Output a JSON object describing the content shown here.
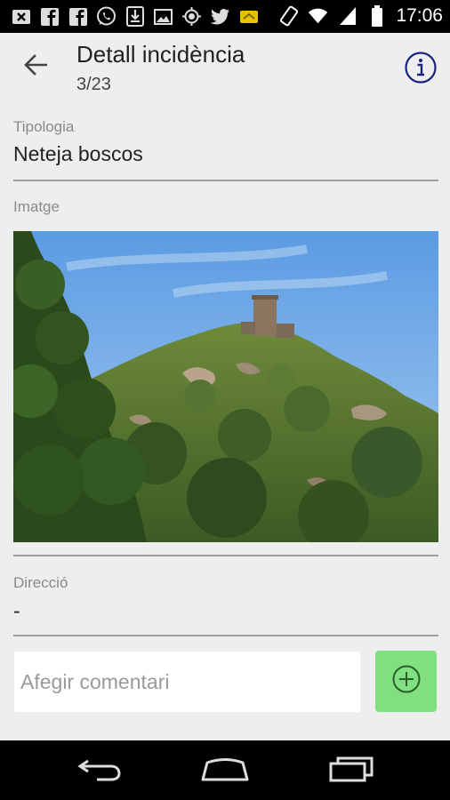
{
  "status_bar": {
    "time": "17:06",
    "left_icons": [
      "close-box-icon",
      "facebook-icon",
      "facebook-icon",
      "whatsapp-icon",
      "download-icon",
      "image-icon",
      "gps-icon",
      "twitter-icon",
      "wallet-icon"
    ],
    "right_icons": [
      "rotate-icon",
      "wifi-icon",
      "signal-icon",
      "battery-icon"
    ]
  },
  "header": {
    "title": "Detall incidència",
    "subtitle": "3/23"
  },
  "fields": {
    "tipologia_label": "Tipologia",
    "tipologia_value": "Neteja boscos",
    "imatge_label": "Imatge",
    "direccio_label": "Direcció",
    "direccio_value": "-"
  },
  "comment": {
    "placeholder": "Afegir comentari",
    "value": ""
  },
  "colors": {
    "background": "#eeeeee",
    "add_button": "#7fe07f",
    "divider": "#9e9e9e"
  }
}
